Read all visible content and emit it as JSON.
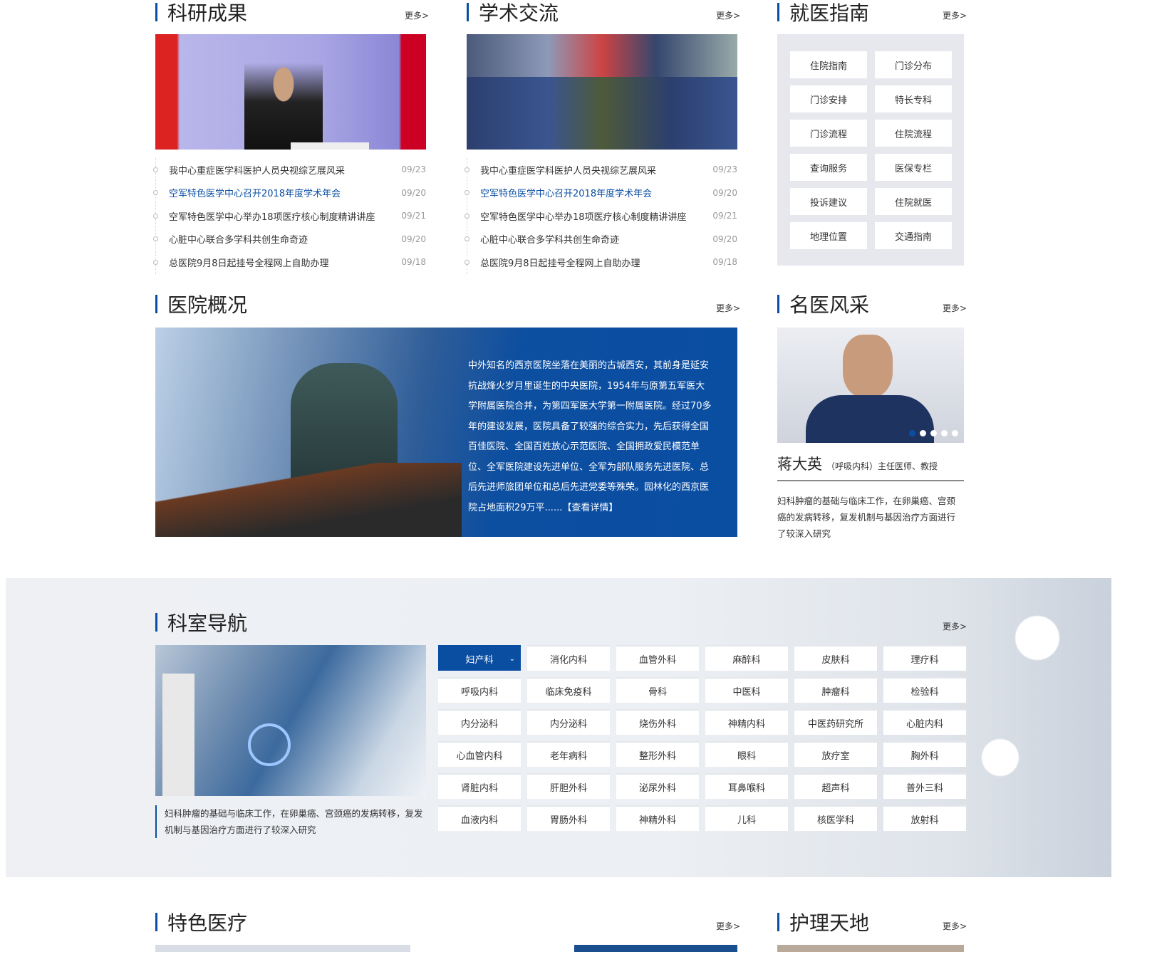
{
  "more_label": "更多>",
  "research": {
    "title": "科研成果",
    "news": [
      {
        "text": "我中心重症医学科医护人员央视综艺展风采",
        "date": "09/23"
      },
      {
        "text": "空军特色医学中心召开2018年度学术年会",
        "date": "09/20",
        "highlight": true
      },
      {
        "text": "空军特色医学中心举办18项医疗核心制度精讲讲座",
        "date": "09/21"
      },
      {
        "text": "心脏中心联合多学科共创生命奇迹",
        "date": "09/20"
      },
      {
        "text": "总医院9月8日起挂号全程网上自助办理",
        "date": "09/18"
      }
    ]
  },
  "academic": {
    "title": "学术交流",
    "news": [
      {
        "text": "我中心重症医学科医护人员央视综艺展风采",
        "date": "09/23"
      },
      {
        "text": "空军特色医学中心召开2018年度学术年会",
        "date": "09/20",
        "highlight": true
      },
      {
        "text": "空军特色医学中心举办18项医疗核心制度精讲讲座",
        "date": "09/21"
      },
      {
        "text": "心脏中心联合多学科共创生命奇迹",
        "date": "09/20"
      },
      {
        "text": "总医院9月8日起挂号全程网上自助办理",
        "date": "09/18"
      }
    ]
  },
  "guide": {
    "title": "就医指南",
    "items": [
      "住院指南",
      "门诊分布",
      "门诊安排",
      "特长专科",
      "门诊流程",
      "住院流程",
      "查询服务",
      "医保专栏",
      "投诉建议",
      "住院就医",
      "地理位置",
      "交通指南"
    ]
  },
  "overview": {
    "title": "医院概况",
    "text": "中外知名的西京医院坐落在美丽的古城西安，其前身是延安抗战烽火岁月里诞生的中央医院，1954年与原第五军医大学附属医院合并，为第四军医大学第一附属医院。经过70多年的建设发展，医院具备了较强的综合实力，先后获得全国百佳医院、全国百姓放心示范医院、全国拥政爱民模范单位、全军医院建设先进单位、全军为部队服务先进医院、总后先进师旅团单位和总后先进党委等殊荣。园林化的西京医院占地面积29万平......",
    "link": "【查看详情】"
  },
  "doctors": {
    "title": "名医风采",
    "name": "蒋大英",
    "role": "（呼吸内科）主任医师、教授",
    "desc": "妇科肿瘤的基础与临床工作，在卵巢癌、宫颈癌的发病转移，复发机制与基因治疗方面进行了较深入研究",
    "slides": 5,
    "active_slide": 1
  },
  "departments": {
    "title": "科室导航",
    "caption": "妇科肿瘤的基础与临床工作，在卵巢癌、宫颈癌的发病转移，复发机制与基因治疗方面进行了较深入研究",
    "items": [
      "妇产科",
      "消化内科",
      "血管外科",
      "麻醉科",
      "皮肤科",
      "理疗科",
      "呼吸内科",
      "临床免疫科",
      "骨科",
      "中医科",
      "肿瘤科",
      "检验科",
      "内分泌科",
      "内分泌科",
      "烧伤外科",
      "神精内科",
      "中医药研究所",
      "心脏内科",
      "心血管内科",
      "老年病科",
      "整形外科",
      "眼科",
      "放疗室",
      "胸外科",
      "肾脏内科",
      "肝胆外科",
      "泌尿外科",
      "耳鼻喉科",
      "超声科",
      "普外三科",
      "血液内科",
      "胃肠外科",
      "神精外科",
      "儿科",
      "核医学科",
      "放射科"
    ],
    "active": 0
  },
  "featured": {
    "title": "特色医疗"
  },
  "nursing": {
    "title": "护理天地"
  },
  "colors": {
    "accent": "#0a4ea2"
  }
}
